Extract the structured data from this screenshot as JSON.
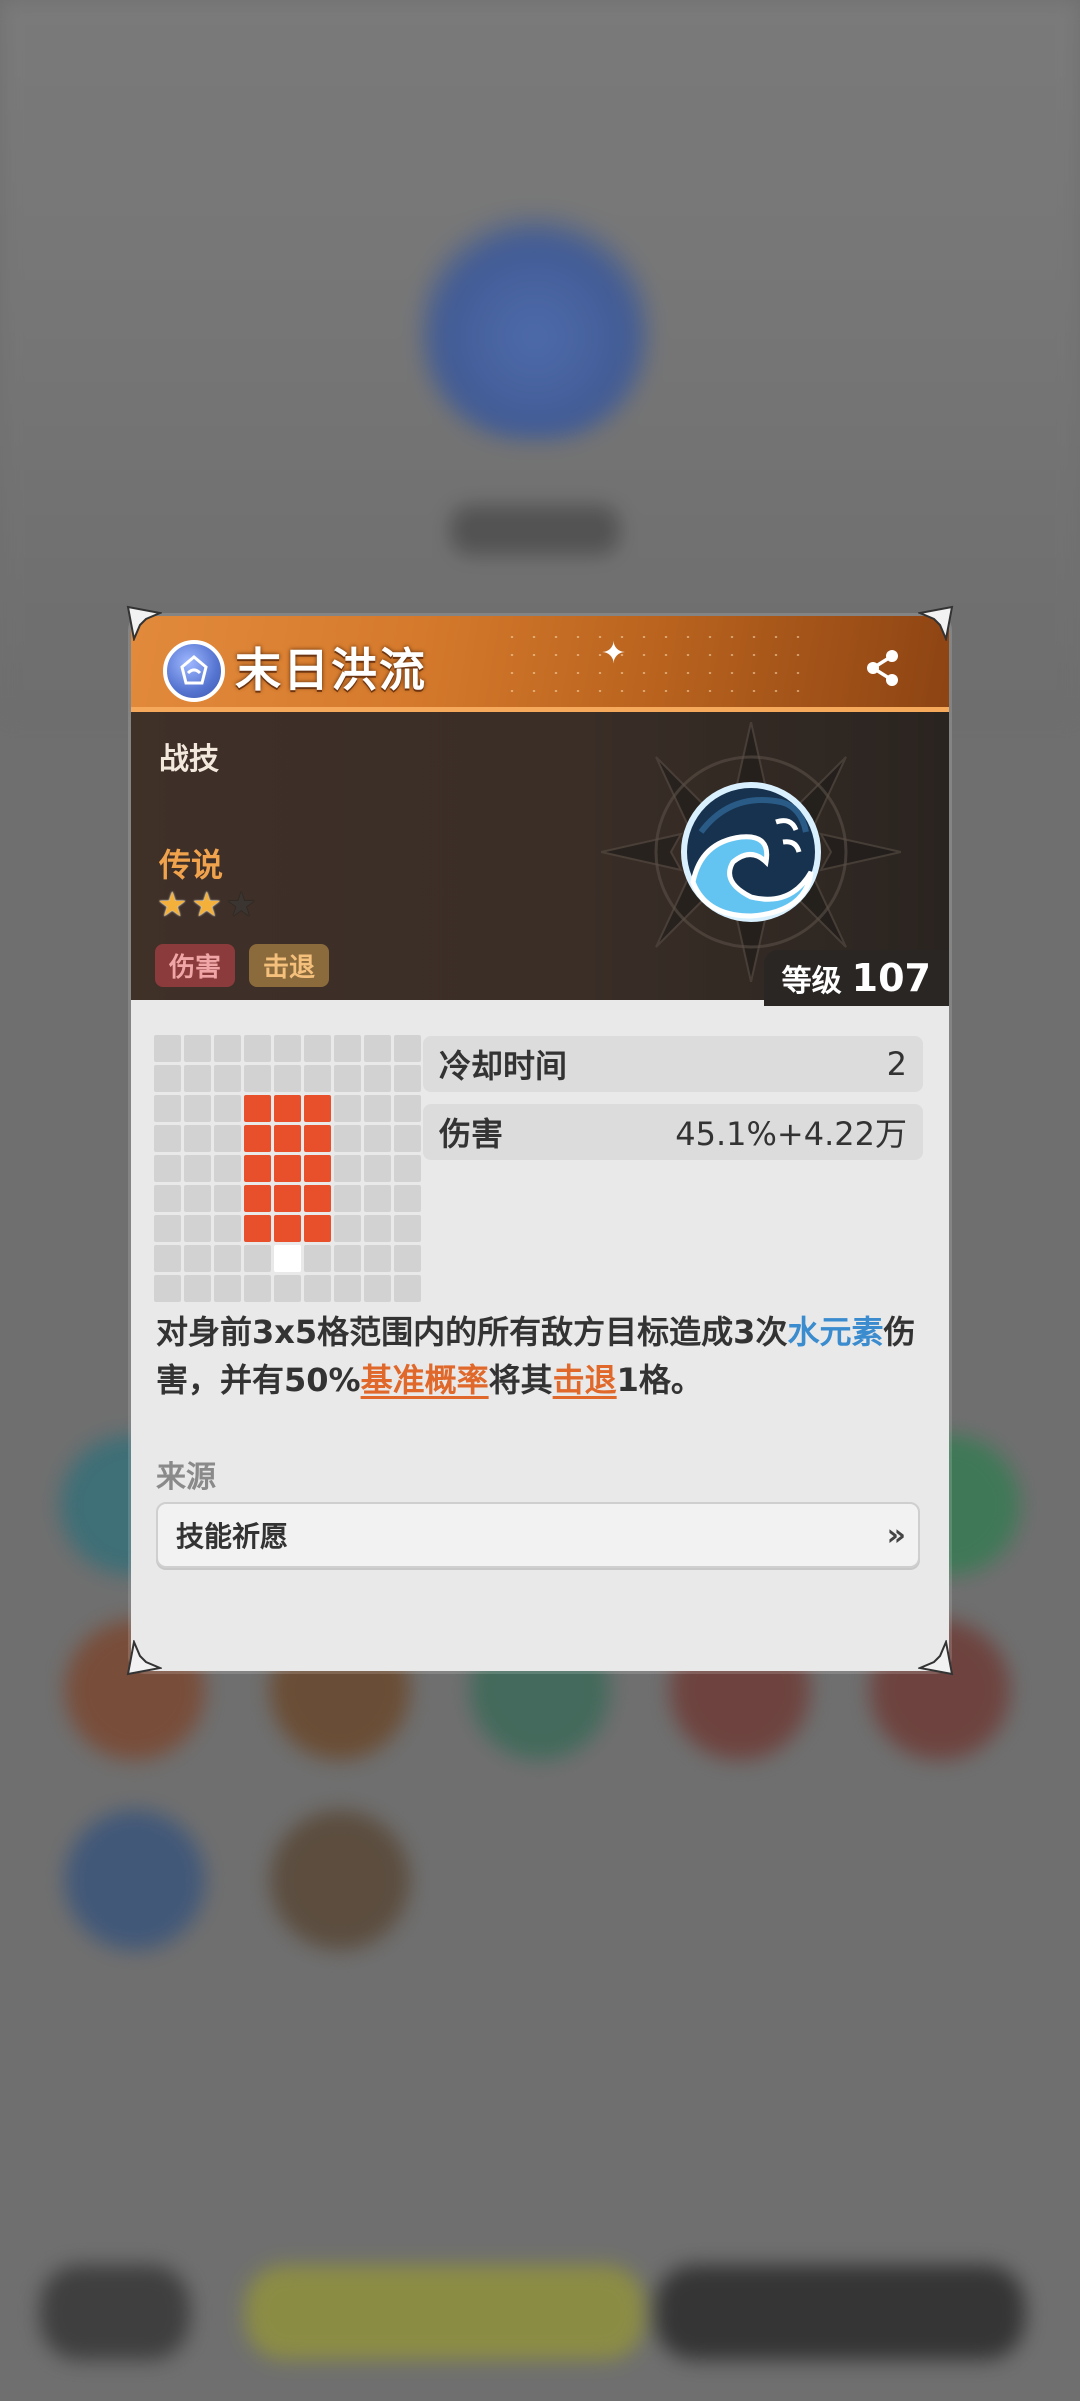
{
  "dialog": {
    "title": "末日洪流",
    "type": "战技",
    "rarity": "传说",
    "stars": {
      "filled": 2,
      "total": 3
    },
    "tags": [
      "伤害",
      "击退"
    ],
    "level_label": "等级",
    "level_value": "107",
    "icons": {
      "element": "water-element-icon",
      "share": "share-icon",
      "skill": "wave-skill-icon",
      "source_arrow": "double-chevron-right-icon"
    },
    "range_grid": {
      "cols": 9,
      "rows": 9,
      "hit_cells": [
        [
          3,
          2
        ],
        [
          4,
          2
        ],
        [
          5,
          2
        ],
        [
          3,
          3
        ],
        [
          4,
          3
        ],
        [
          5,
          3
        ],
        [
          3,
          4
        ],
        [
          4,
          4
        ],
        [
          5,
          4
        ],
        [
          3,
          5
        ],
        [
          4,
          5
        ],
        [
          5,
          5
        ],
        [
          3,
          6
        ],
        [
          4,
          6
        ],
        [
          5,
          6
        ]
      ],
      "self_cell": [
        4,
        7
      ]
    },
    "stats": [
      {
        "label": "冷却时间",
        "value": "2"
      },
      {
        "label": "伤害",
        "value": "45.1%+4.22万"
      }
    ],
    "description": {
      "part1": "对身前3x5格范围内的所有敌方目标造成3次",
      "element_keyword": "水元素",
      "part2": "伤害，并有50%",
      "keyword1": "基准概率",
      "part3": "将其",
      "keyword2": "击退",
      "part4": "1格。"
    },
    "source_label": "来源",
    "source_item": "技能祈愿"
  },
  "colors": {
    "header_orange": "#e28a3c",
    "hit_cell": "#e8502b",
    "water_keyword": "#3a8ccf",
    "link_keyword": "#e0682a",
    "rarity": "#f0a24c"
  }
}
